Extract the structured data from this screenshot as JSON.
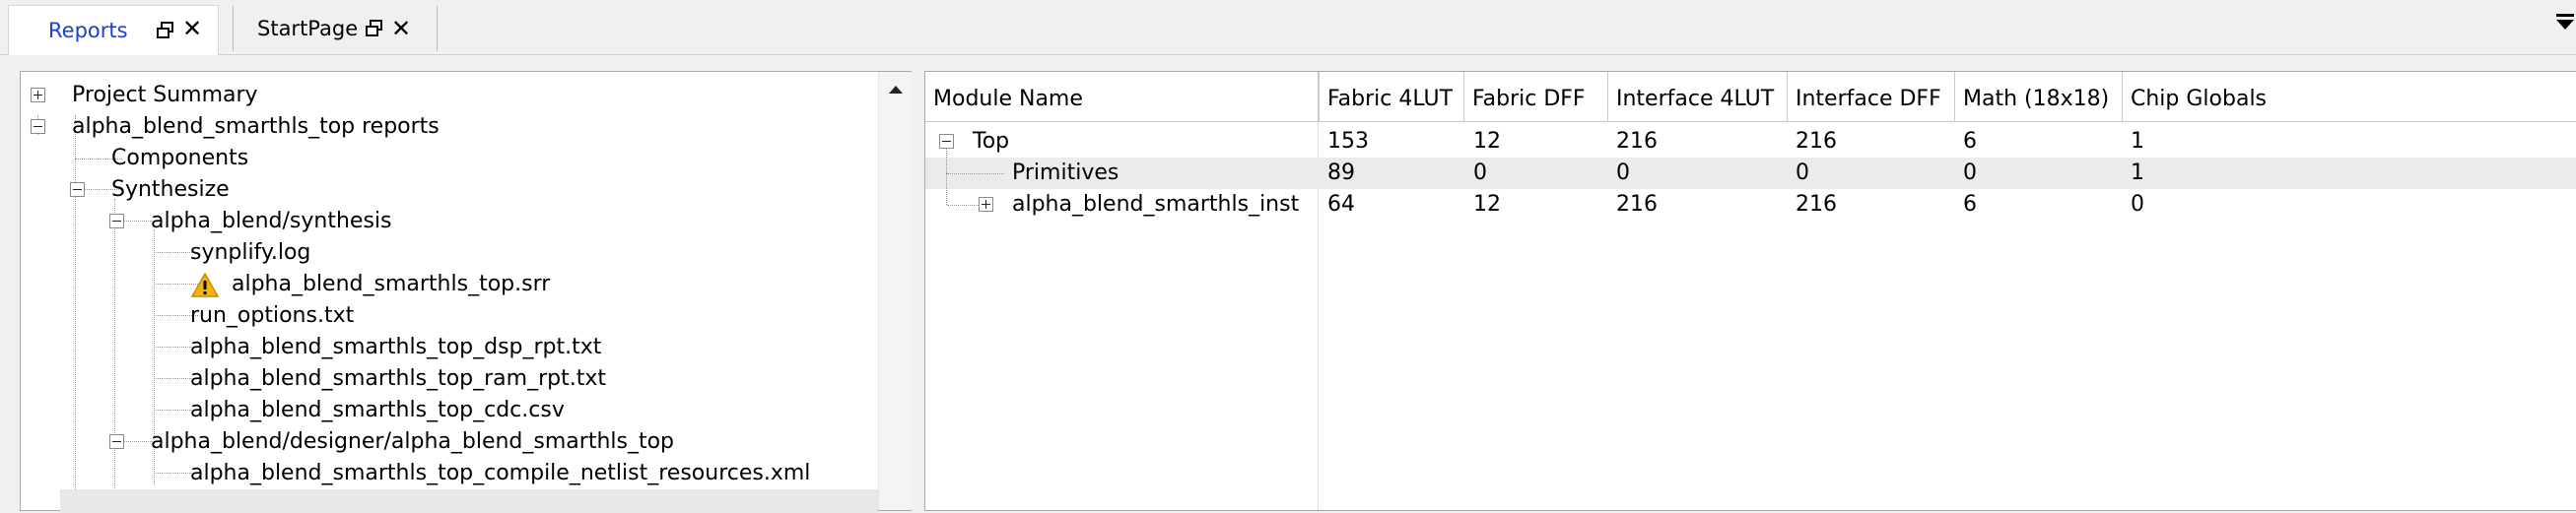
{
  "tabs": [
    {
      "label": "Reports",
      "active": true
    },
    {
      "label": "StartPage",
      "active": false
    }
  ],
  "colors": {
    "active_tab_text": "#1a3fd1",
    "warning": "#f2b705"
  },
  "tree": {
    "items": [
      {
        "label": "Project Summary",
        "expander": "plus"
      },
      {
        "label": "alpha_blend_smarthls_top reports",
        "expander": "minus"
      },
      {
        "label": "Components"
      },
      {
        "label": "Synthesize",
        "expander": "minus"
      },
      {
        "label": "alpha_blend/synthesis",
        "expander": "minus"
      },
      {
        "label": "synplify.log"
      },
      {
        "label": "alpha_blend_smarthls_top.srr",
        "icon": "warning-icon"
      },
      {
        "label": "run_options.txt"
      },
      {
        "label": "alpha_blend_smarthls_top_dsp_rpt.txt"
      },
      {
        "label": "alpha_blend_smarthls_top_ram_rpt.txt"
      },
      {
        "label": "alpha_blend_smarthls_top_cdc.csv"
      },
      {
        "label": "alpha_blend/designer/alpha_blend_smarthls_top",
        "expander": "minus"
      },
      {
        "label": "alpha_blend_smarthls_top_compile_netlist_resources.xml"
      }
    ]
  },
  "table": {
    "columns": [
      "Module Name",
      "Fabric 4LUT",
      "Fabric DFF",
      "Interface 4LUT",
      "Interface DFF",
      "Math (18x18)",
      "Chip Globals"
    ],
    "rows": [
      {
        "name": "Top",
        "expander": "minus",
        "values": [
          "153",
          "12",
          "216",
          "216",
          "6",
          "1"
        ]
      },
      {
        "name": "Primitives",
        "values": [
          "89",
          "0",
          "0",
          "0",
          "0",
          "1"
        ]
      },
      {
        "name": "alpha_blend_smarthls_inst",
        "expander": "plus",
        "values": [
          "64",
          "12",
          "216",
          "216",
          "6",
          "0"
        ]
      }
    ]
  }
}
